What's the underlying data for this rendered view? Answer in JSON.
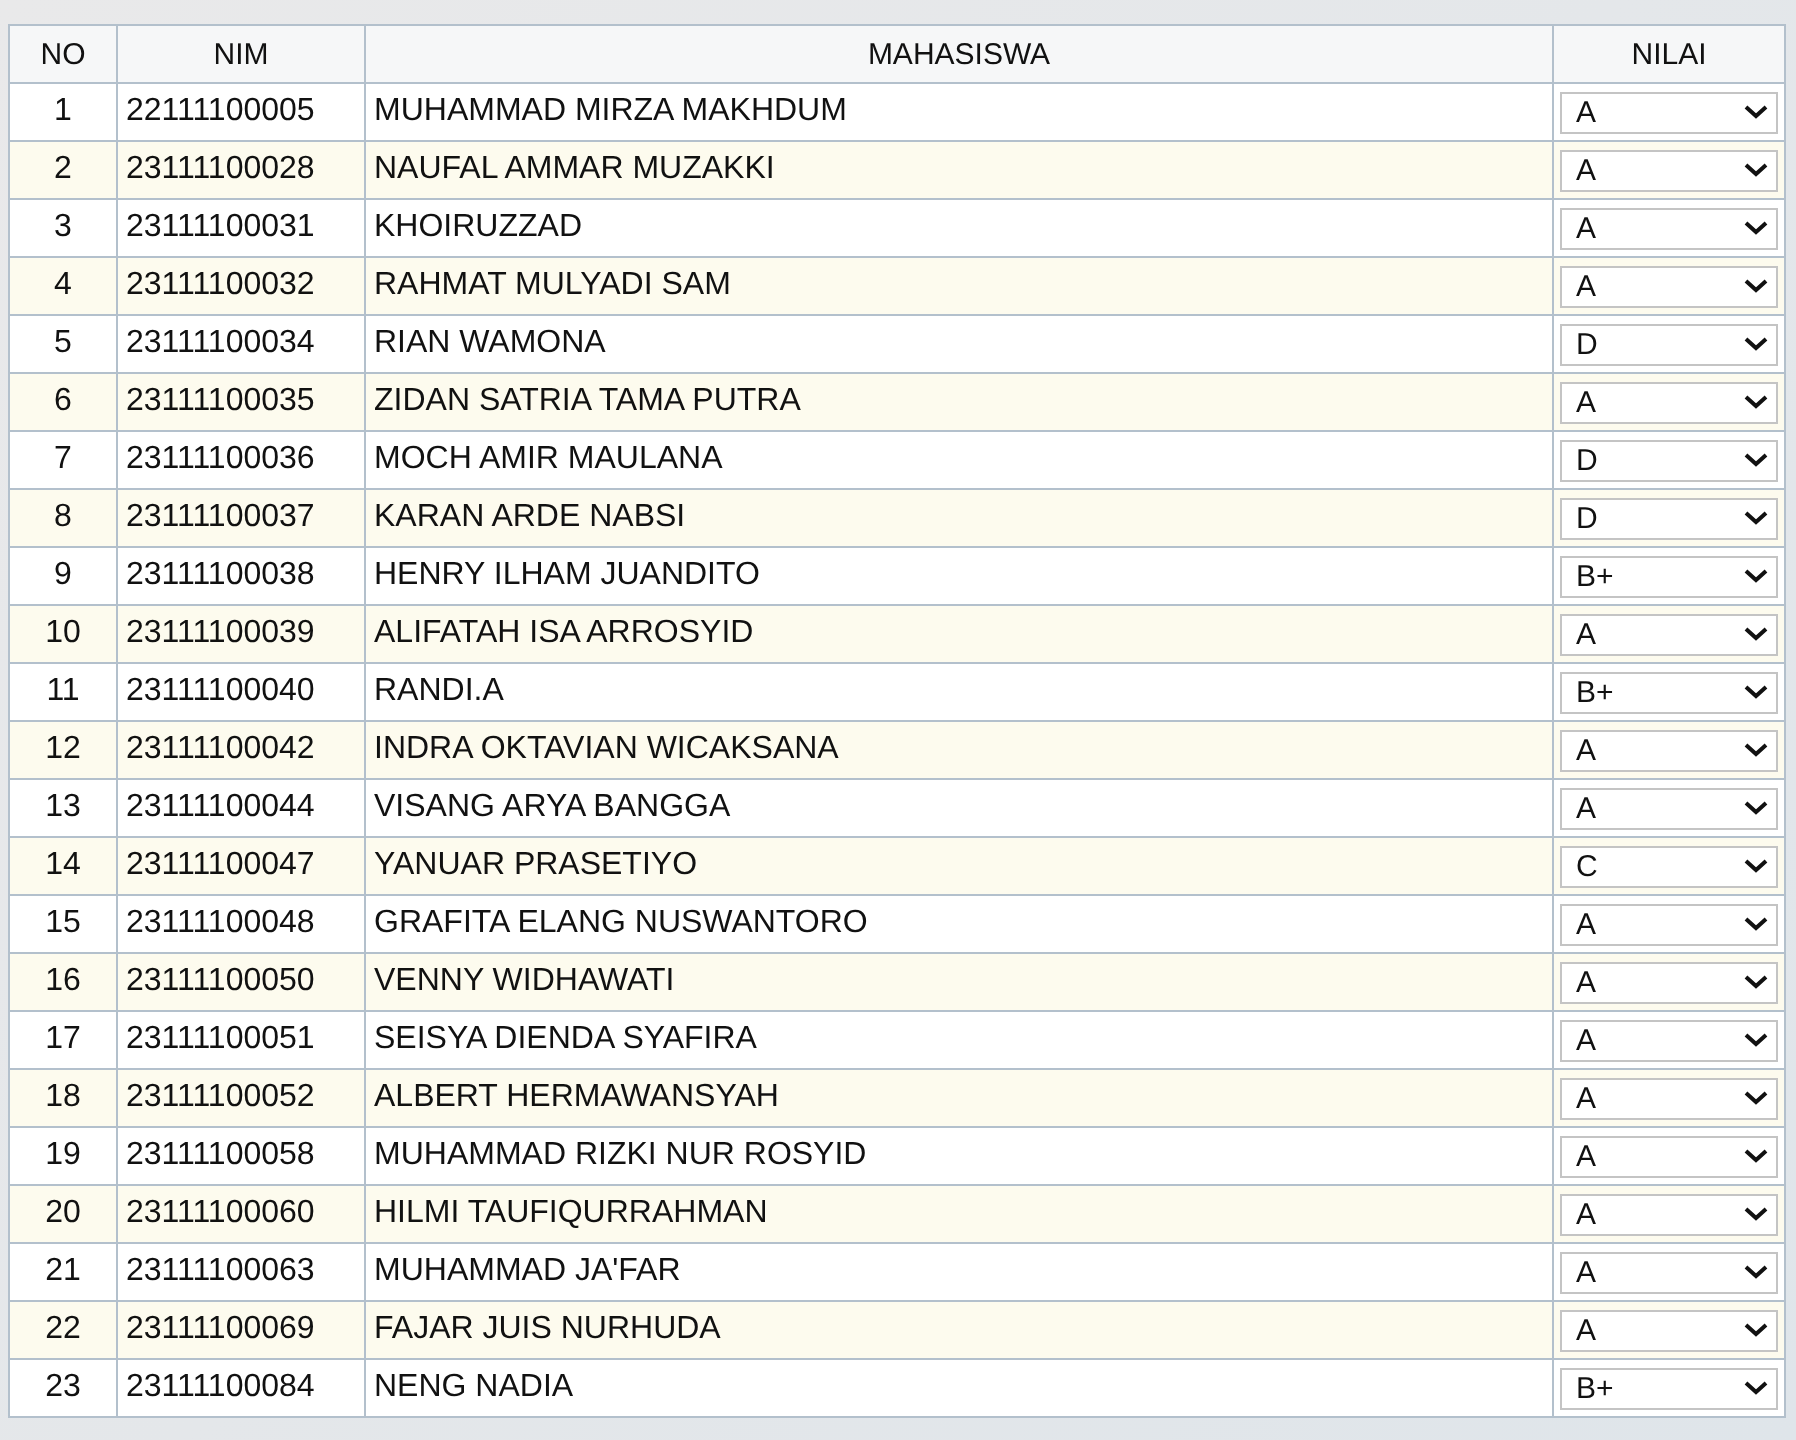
{
  "table": {
    "columns": [
      "NO",
      "NIM",
      "MAHASISWA",
      "NILAI"
    ],
    "rows": [
      {
        "no": "1",
        "nim": "22111100005",
        "name": "MUHAMMAD MIRZA MAKHDUM",
        "grade": "A"
      },
      {
        "no": "2",
        "nim": "23111100028",
        "name": "NAUFAL AMMAR MUZAKKI",
        "grade": "A"
      },
      {
        "no": "3",
        "nim": "23111100031",
        "name": "KHOIRUZZAD",
        "grade": "A"
      },
      {
        "no": "4",
        "nim": "23111100032",
        "name": "RAHMAT MULYADI SAM",
        "grade": "A"
      },
      {
        "no": "5",
        "nim": "23111100034",
        "name": "RIAN WAMONA",
        "grade": "D"
      },
      {
        "no": "6",
        "nim": "23111100035",
        "name": "ZIDAN SATRIA TAMA PUTRA",
        "grade": "A"
      },
      {
        "no": "7",
        "nim": "23111100036",
        "name": "MOCH AMIR MAULANA",
        "grade": "D"
      },
      {
        "no": "8",
        "nim": "23111100037",
        "name": "KARAN ARDE NABSI",
        "grade": "D"
      },
      {
        "no": "9",
        "nim": "23111100038",
        "name": "HENRY ILHAM JUANDITO",
        "grade": "B+"
      },
      {
        "no": "10",
        "nim": "23111100039",
        "name": "ALIFATAH ISA ARROSYID",
        "grade": "A"
      },
      {
        "no": "11",
        "nim": "23111100040",
        "name": "RANDI.A",
        "grade": "B+"
      },
      {
        "no": "12",
        "nim": "23111100042",
        "name": "INDRA OKTAVIAN WICAKSANA",
        "grade": "A"
      },
      {
        "no": "13",
        "nim": "23111100044",
        "name": "VISANG ARYA BANGGA",
        "grade": "A"
      },
      {
        "no": "14",
        "nim": "23111100047",
        "name": "YANUAR PRASETIYO",
        "grade": "C"
      },
      {
        "no": "15",
        "nim": "23111100048",
        "name": "GRAFITA ELANG NUSWANTORO",
        "grade": "A"
      },
      {
        "no": "16",
        "nim": "23111100050",
        "name": "VENNY WIDHAWATI",
        "grade": "A"
      },
      {
        "no": "17",
        "nim": "23111100051",
        "name": "SEISYA DIENDA SYAFIRA",
        "grade": "A"
      },
      {
        "no": "18",
        "nim": "23111100052",
        "name": "ALBERT HERMAWANSYAH",
        "grade": "A"
      },
      {
        "no": "19",
        "nim": "23111100058",
        "name": "MUHAMMAD RIZKI NUR ROSYID",
        "grade": "A"
      },
      {
        "no": "20",
        "nim": "23111100060",
        "name": "HILMI TAUFIQURRAHMAN",
        "grade": "A"
      },
      {
        "no": "21",
        "nim": "23111100063",
        "name": "MUHAMMAD JA'FAR",
        "grade": "A"
      },
      {
        "no": "22",
        "nim": "23111100069",
        "name": "FAJAR JUIS NURHUDA",
        "grade": "A"
      },
      {
        "no": "23",
        "nim": "23111100084",
        "name": "NENG NADIA",
        "grade": "B+"
      }
    ]
  }
}
